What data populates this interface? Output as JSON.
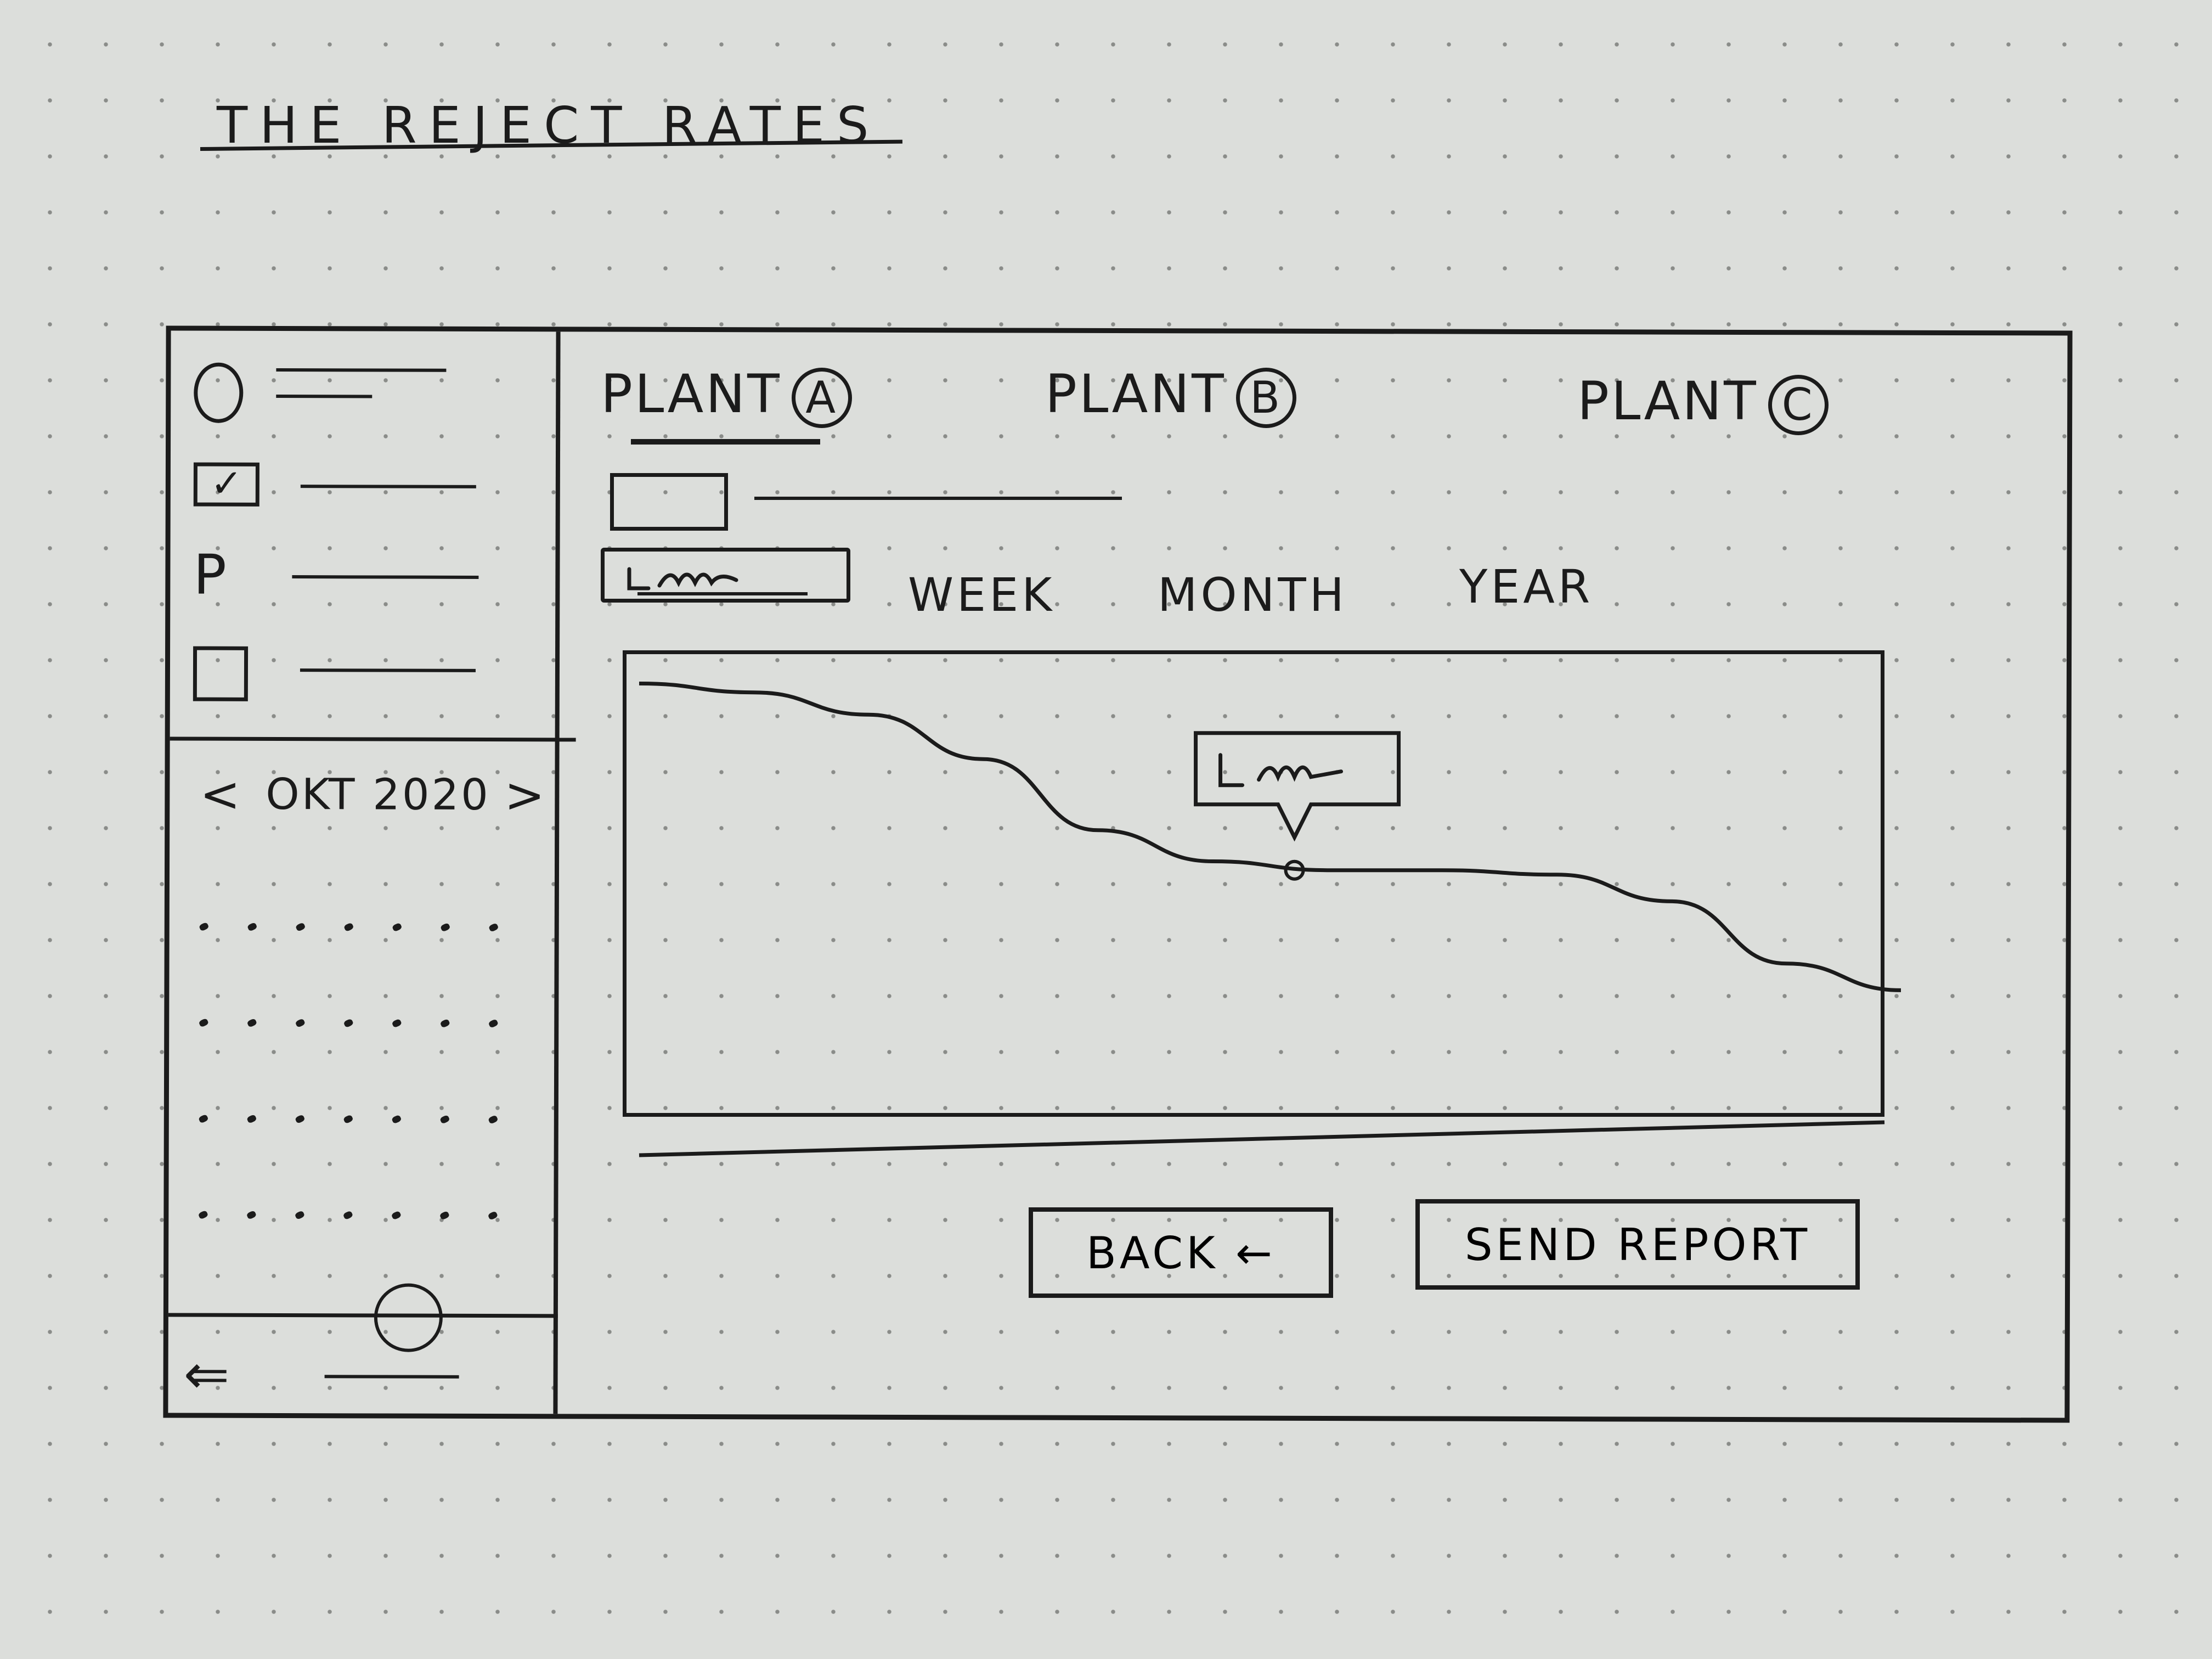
{
  "page_title": "THE REJECT RATES",
  "sidebar": {
    "items": [
      {
        "icon": "circle-icon"
      },
      {
        "icon": "checkbox-checked-icon",
        "glyph": "✓"
      },
      {
        "icon": "p-icon",
        "glyph": "P"
      },
      {
        "icon": "square-icon"
      }
    ],
    "calendar": {
      "prev": "<",
      "month": "OKT 2020",
      "next": ">",
      "selected_icon": "selected-day-circle"
    },
    "footer": {
      "icon": "logout-icon",
      "glyph": "⇐"
    }
  },
  "tabs": [
    {
      "label": "PLANT",
      "badge": "A",
      "active": true
    },
    {
      "label": "PLANT",
      "badge": "B",
      "active": false
    },
    {
      "label": "PLANT",
      "badge": "C",
      "active": false
    }
  ],
  "period_tabs": {
    "selected_icon": "scribble-icon",
    "week": "WEEK",
    "month": "MONTH",
    "year": "YEAR"
  },
  "chart_data": {
    "type": "line",
    "title": "",
    "xlabel": "",
    "ylabel": "",
    "series": [
      {
        "values": [
          0.95,
          0.93,
          0.88,
          0.78,
          0.62,
          0.55,
          0.53,
          0.53,
          0.52,
          0.46,
          0.32,
          0.26
        ]
      }
    ],
    "tooltip": {
      "point_index": 6,
      "icon": "scribble-icon"
    },
    "ylim": [
      0,
      1
    ]
  },
  "actions": {
    "back": "BACK ←",
    "send": "SEND REPORT"
  }
}
